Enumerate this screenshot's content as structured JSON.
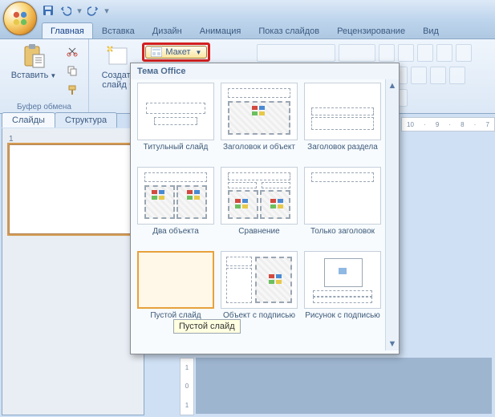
{
  "qat": {
    "save": "save-icon",
    "undo": "undo-icon",
    "redo": "redo-icon"
  },
  "tabs": [
    "Главная",
    "Вставка",
    "Дизайн",
    "Анимация",
    "Показ слайдов",
    "Рецензирование",
    "Вид"
  ],
  "active_tab": 0,
  "ribbon": {
    "clipboard": {
      "label": "Буфер обмена",
      "paste": "Вставить"
    },
    "slide_group": {
      "new_slide": "Создать\nслайд",
      "layout_btn": "Макет"
    }
  },
  "side_tabs": {
    "slides": "Слайды",
    "outline": "Структура"
  },
  "slide_number": "1",
  "gallery": {
    "title": "Тема Office",
    "items": [
      {
        "name": "title",
        "caption": "Титульный слайд"
      },
      {
        "name": "title-content",
        "caption": "Заголовок и объект"
      },
      {
        "name": "section",
        "caption": "Заголовок раздела"
      },
      {
        "name": "two-content",
        "caption": "Два объекта"
      },
      {
        "name": "comparison",
        "caption": "Сравнение"
      },
      {
        "name": "title-only",
        "caption": "Только заголовок"
      },
      {
        "name": "blank",
        "caption": "Пустой слайд",
        "selected": true
      },
      {
        "name": "content-caption",
        "caption": "Объект с подписью"
      },
      {
        "name": "picture-caption",
        "caption": "Рисунок с подписью"
      }
    ]
  },
  "tooltip": "Пустой слайд",
  "ruler_h": [
    "10",
    "9",
    "8",
    "7"
  ],
  "ruler_v": [
    "1",
    "0",
    "1"
  ]
}
